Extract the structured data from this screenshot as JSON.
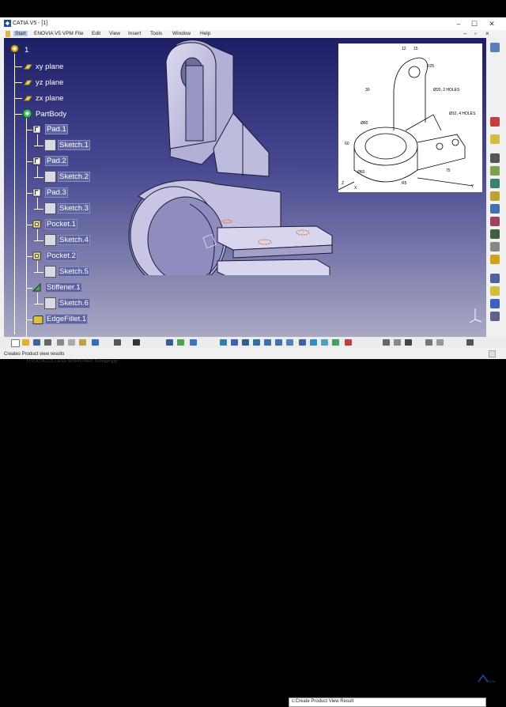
{
  "window": {
    "title": "CATIA V5 - [1]"
  },
  "menu": {
    "items": [
      "Start",
      "ENOVIA V5 VPM",
      "File",
      "Edit",
      "View",
      "Insert",
      "Tools",
      "Window",
      "Help"
    ]
  },
  "tree": {
    "root": "1",
    "nodes": {
      "xy": "xy plane",
      "yz": "yz plane",
      "zx": "zx plane",
      "partbody": "PartBody",
      "pad1": "Pad.1",
      "sketch1": "Sketch.1",
      "pad2": "Pad.2",
      "sketch2": "Sketch.2",
      "pad3": "Pad.3",
      "sketch3": "Sketch.3",
      "pocket1": "Pocket.1",
      "sketch4": "Sketch.4",
      "pocket2": "Pocket.2",
      "sketch5": "Sketch.5",
      "stiffener1": "Stiffener.1",
      "sketch6": "Sketch.6",
      "edgefillet1": "EdgeFillet.1"
    }
  },
  "status": {
    "message": "Creates Product view results",
    "command": "c:Create Product View Result"
  },
  "file_path": "D:\\CATIA COLLEGE WORK\\PART 5\\image.jpg",
  "reference_drawing": {
    "labels": [
      "R25",
      "Ø20, 2 HOLES",
      "Ø10, 4 HOLES",
      "Ø80",
      "Ø60",
      "R5",
      "75",
      "60",
      "30",
      "X",
      "Y",
      "Z",
      "12",
      "15"
    ]
  },
  "colors": {
    "viewport_top": "#1d1f66",
    "viewport_bottom": "#a9a9c4",
    "part_fill": "#c6c4e4",
    "tree_selection": "#5f63a0"
  }
}
